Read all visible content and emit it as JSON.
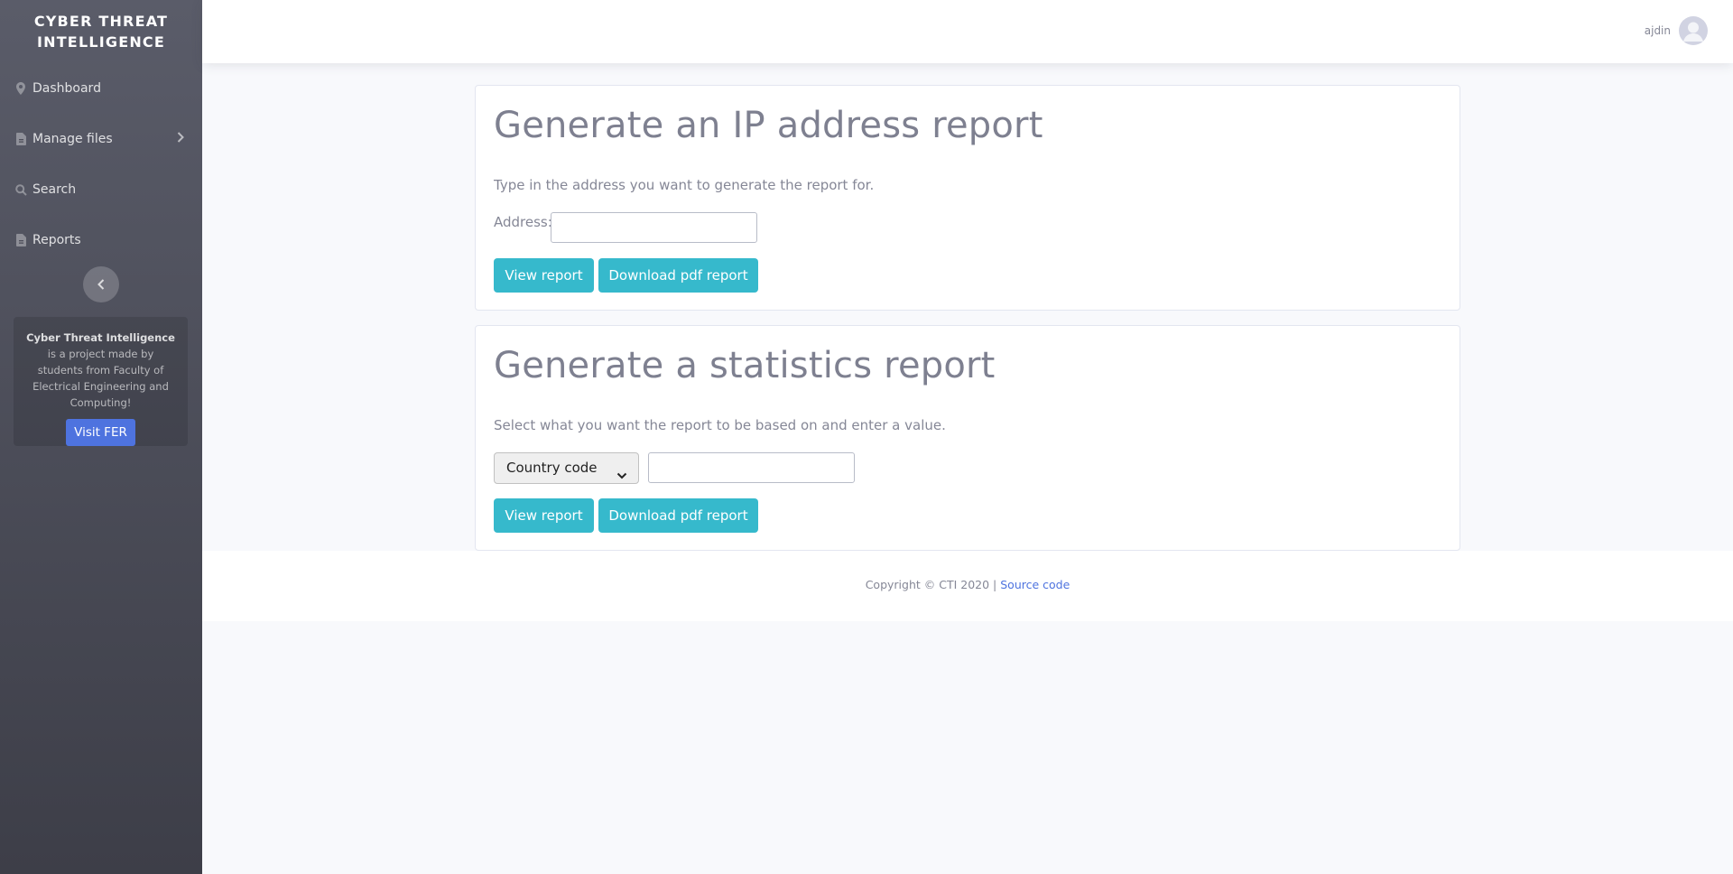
{
  "brand": {
    "line1": "CYBER THREAT",
    "line2": "INTELLIGENCE"
  },
  "sidebar": {
    "items": [
      {
        "label": "Dashboard",
        "icon": "map-marker-icon"
      },
      {
        "label": "Manage files",
        "icon": "file-icon"
      },
      {
        "label": "Search",
        "icon": "search-icon"
      },
      {
        "label": "Reports",
        "icon": "file-icon"
      }
    ],
    "card": {
      "bold": "Cyber Threat Intelligence",
      "text": " is a project made by students from Faculty of Electrical Engineering and Computing!",
      "button": "Visit FER"
    }
  },
  "topbar": {
    "user_name": "ajdin"
  },
  "ip_report": {
    "title": "Generate an IP address report",
    "description": "Type in the address you want to generate the report for.",
    "address_label": "Address:",
    "address_value": "",
    "view_button": "View report",
    "download_button": "Download pdf report"
  },
  "stats_report": {
    "title": "Generate a statistics report",
    "description": "Select what you want the report to be based on and enter a value.",
    "select_value": "Country code",
    "value_input": "",
    "view_button": "View report",
    "download_button": "Download pdf report"
  },
  "footer": {
    "text": "Copyright © CTI 2020 | ",
    "link": "Source code"
  },
  "colors": {
    "primary": "#4e73df",
    "info": "#36b9cc",
    "sidebar": "#5a5c69"
  }
}
